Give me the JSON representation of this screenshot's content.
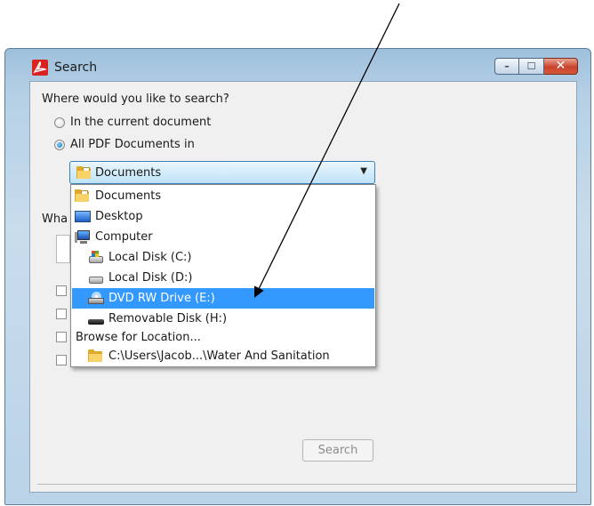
{
  "window": {
    "title": "Search",
    "icon": "acrobat-icon",
    "close_glyph": "✕",
    "min_glyph": "–",
    "max_glyph": "☐"
  },
  "where": {
    "question": "Where would you like to search?",
    "options": [
      {
        "label": "In the current document",
        "selected": false
      },
      {
        "label": "All PDF Documents in",
        "selected": true
      }
    ]
  },
  "location": {
    "selected": "Documents",
    "icon": "folder-documents-icon",
    "arrow": "▼"
  },
  "dropdown_items": [
    {
      "label": "Documents",
      "icon": "folder-documents-icon",
      "selected": false
    },
    {
      "label": "Desktop",
      "icon": "desktop-icon",
      "selected": false
    },
    {
      "label": "Computer",
      "icon": "computer-icon",
      "selected": false
    },
    {
      "label": "Local Disk (C:)",
      "icon": "local-disk-icon",
      "selected": false
    },
    {
      "label": "Local Disk (D:)",
      "icon": "hard-disk-icon",
      "selected": false
    },
    {
      "label": "DVD RW Drive (E:)",
      "icon": "dvd-drive-icon",
      "selected": true
    },
    {
      "label": "Removable Disk (H:)",
      "icon": "removable-disk-icon",
      "selected": false
    },
    {
      "label": "Browse for Location...",
      "icon": "",
      "selected": false
    },
    {
      "label": "C:\\Users\\Jacob...\\Water And Sanitation",
      "icon": "folder-icon",
      "selected": false
    }
  ],
  "behind": {
    "question_partial": "Wha"
  },
  "search_button": "Search",
  "colors": {
    "selection": "#3399ff",
    "close_button": "#c8432c",
    "accent_folder": "#e0a928"
  }
}
